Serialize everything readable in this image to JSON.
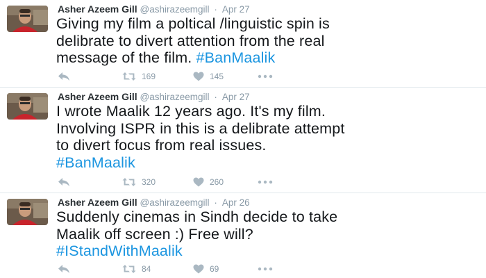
{
  "tweets": [
    {
      "author_name": "Asher Azeem Gill",
      "handle": "@ashirazeemgill",
      "separator": "·",
      "time": "Apr 27",
      "text_plain": "Giving my film a poltical /linguistic spin is delibrate to divert attention from the real message of the film. ",
      "lines": [
        "Giving my film a poltical /linguistic spin is",
        "delibrate to divert attention from the real",
        "message of the film. "
      ],
      "hashtag": "#BanMaalik",
      "retweets": "169",
      "likes": "145"
    },
    {
      "author_name": "Asher Azeem Gill",
      "handle": "@ashirazeemgill",
      "separator": "·",
      "time": "Apr 27",
      "lines": [
        "I wrote Maalik 12 years ago. It's my film.",
        "Involving ISPR in this is a delibrate attempt",
        "to divert focus from real issues."
      ],
      "hashtag": "#BanMaalik",
      "retweets": "320",
      "likes": "260"
    },
    {
      "author_name": "Asher Azeem Gill",
      "handle": "@ashirazeemgill",
      "separator": "·",
      "time": "Apr 26",
      "lines": [
        "Suddenly cinemas in Sindh decide to take",
        "Maalik off screen :) Free will?"
      ],
      "hashtag": "#IStandWithMaalik",
      "retweets": "84",
      "likes": "69"
    }
  ],
  "colors": {
    "name": "#292f33",
    "meta": "#8899a6",
    "text": "#14171a",
    "hashtag": "#1b95e0",
    "divider": "#e1e8ed"
  },
  "icons": {
    "reply": "reply-arrow-icon",
    "retweet": "retweet-icon",
    "like": "heart-icon",
    "more": "more-dots-icon"
  }
}
